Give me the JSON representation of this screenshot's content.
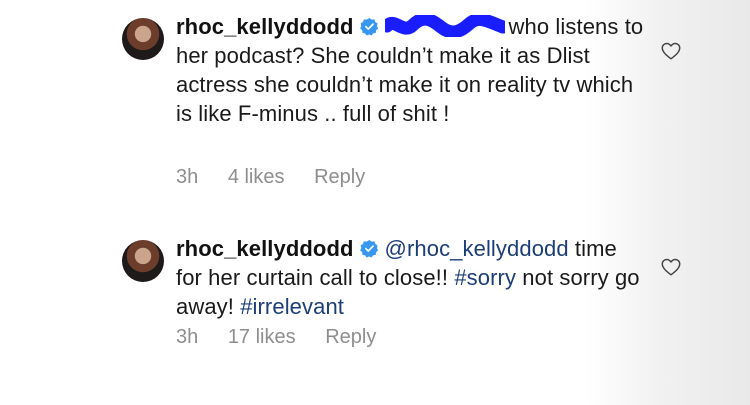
{
  "comments": [
    {
      "username": "rhoc_kellyddodd",
      "verified": true,
      "mention": "",
      "text_segments": [
        {
          "type": "text",
          "value": "who listens to her podcast?  She couldn’t make it as Dlist actress she couldn’t make it on reality tv which is like F-minus .. full of shit !"
        }
      ],
      "time": "3h",
      "likes": "4 likes",
      "reply": "Reply"
    },
    {
      "username": "rhoc_kellyddodd",
      "verified": true,
      "mention": "@rhoc_kellyddodd",
      "text_segments": [
        {
          "type": "text",
          "value": " time for her curtain call to close!! "
        },
        {
          "type": "hashtag",
          "value": "#sorry"
        },
        {
          "type": "text",
          "value": " not sorry go away!  "
        },
        {
          "type": "hashtag",
          "value": "#irrelevant"
        }
      ],
      "time": "3h",
      "likes": "17 likes",
      "reply": "Reply"
    }
  ],
  "icons": {
    "verified": "verified-badge-icon",
    "heart": "heart-outline-icon"
  },
  "colors": {
    "link": "#1c3d78",
    "meta": "#8e8e8e",
    "verified": "#3897f0",
    "redaction": "#1a1dff"
  }
}
